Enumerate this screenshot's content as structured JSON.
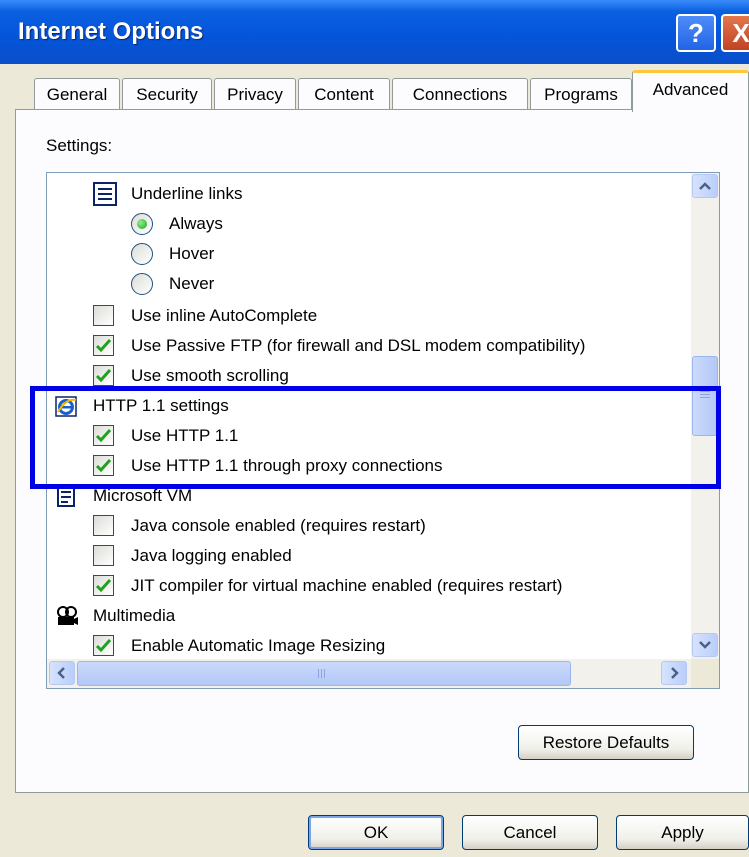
{
  "window": {
    "title": "Internet Options",
    "help_glyph": "?",
    "close_glyph": "X"
  },
  "tabs": [
    {
      "label": "General",
      "active": false
    },
    {
      "label": "Security",
      "active": false
    },
    {
      "label": "Privacy",
      "active": false
    },
    {
      "label": "Content",
      "active": false
    },
    {
      "label": "Connections",
      "active": false
    },
    {
      "label": "Programs",
      "active": false
    },
    {
      "label": "Advanced",
      "active": true
    }
  ],
  "settings_label": "Settings:",
  "settings": {
    "underline_links": {
      "label": "Underline links",
      "icon": "settings-list-icon"
    },
    "always": {
      "label": "Always",
      "checked": true
    },
    "hover": {
      "label": "Hover",
      "checked": false
    },
    "never": {
      "label": "Never",
      "checked": false
    },
    "inline_autocomplete": {
      "label": "Use inline AutoComplete",
      "checked": false
    },
    "passive_ftp": {
      "label": "Use Passive FTP (for firewall and DSL modem compatibility)",
      "checked": true
    },
    "smooth_scrolling": {
      "label": "Use smooth scrolling",
      "checked": true
    },
    "http11_settings": {
      "label": "HTTP 1.1 settings",
      "icon": "internet-explorer-icon"
    },
    "use_http11": {
      "label": "Use HTTP 1.1",
      "checked": true
    },
    "use_http11_proxy": {
      "label": "Use HTTP 1.1 through proxy connections",
      "checked": true
    },
    "microsoft_vm": {
      "label": "Microsoft VM",
      "icon": "document-icon"
    },
    "java_console": {
      "label": "Java console enabled (requires restart)",
      "checked": false
    },
    "java_logging": {
      "label": "Java logging enabled",
      "checked": false
    },
    "jit_compiler": {
      "label": "JIT compiler for virtual machine enabled (requires restart)",
      "checked": true
    },
    "multimedia": {
      "label": "Multimedia",
      "icon": "multimedia-icon"
    },
    "auto_image_resizing": {
      "label": "Enable Automatic Image Resizing",
      "checked": true
    }
  },
  "buttons": {
    "restore_defaults": "Restore Defaults",
    "ok": "OK",
    "cancel": "Cancel",
    "apply": "Apply"
  },
  "colors": {
    "highlight_box": "#0000e6",
    "title_bar": "#0454d9",
    "checkmark": "#21a121"
  }
}
